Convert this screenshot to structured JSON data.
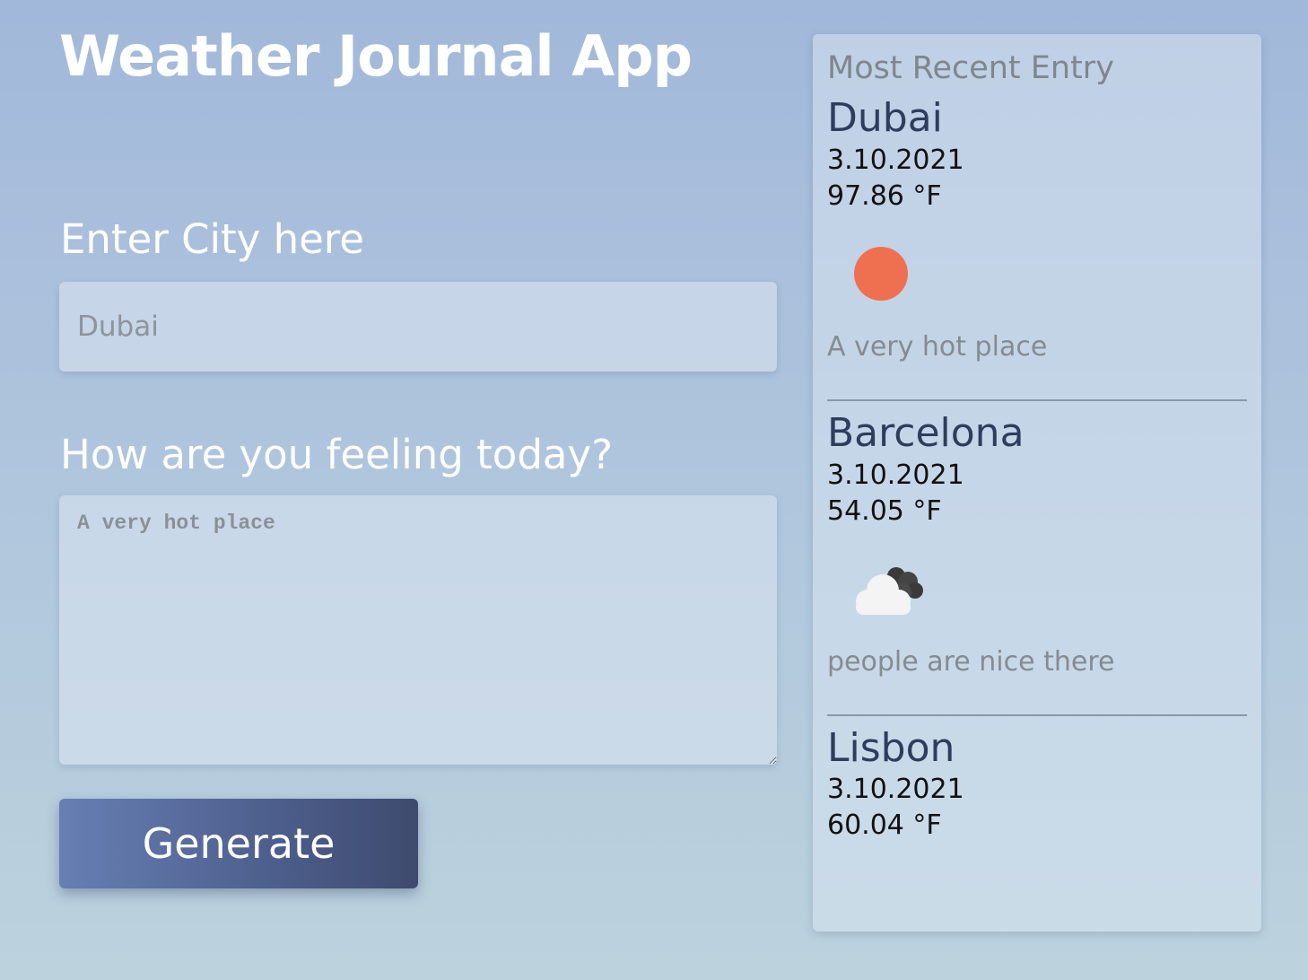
{
  "app": {
    "title": "Weather Journal App"
  },
  "form": {
    "city_label": "Enter City here",
    "city_placeholder": "Dubai",
    "feeling_label": "How are you feeling today?",
    "feeling_placeholder": "A very hot place",
    "generate_label": "Generate"
  },
  "recent": {
    "title": "Most Recent Entry",
    "entries": [
      {
        "city": "Dubai",
        "date": "3.10.2021",
        "temp": "97.86 °F",
        "icon": "sun-icon",
        "note": "A very hot place"
      },
      {
        "city": "Barcelona",
        "date": "3.10.2021",
        "temp": "54.05 °F",
        "icon": "cloud-icon",
        "note": "people are nice there"
      },
      {
        "city": "Lisbon",
        "date": "3.10.2021",
        "temp": "60.04 °F",
        "icon": "",
        "note": ""
      }
    ]
  },
  "colors": {
    "sun": "#ef7050",
    "button_start": "#677fb4",
    "button_end": "#3e4b6e",
    "city_text": "#2e3d5c"
  }
}
